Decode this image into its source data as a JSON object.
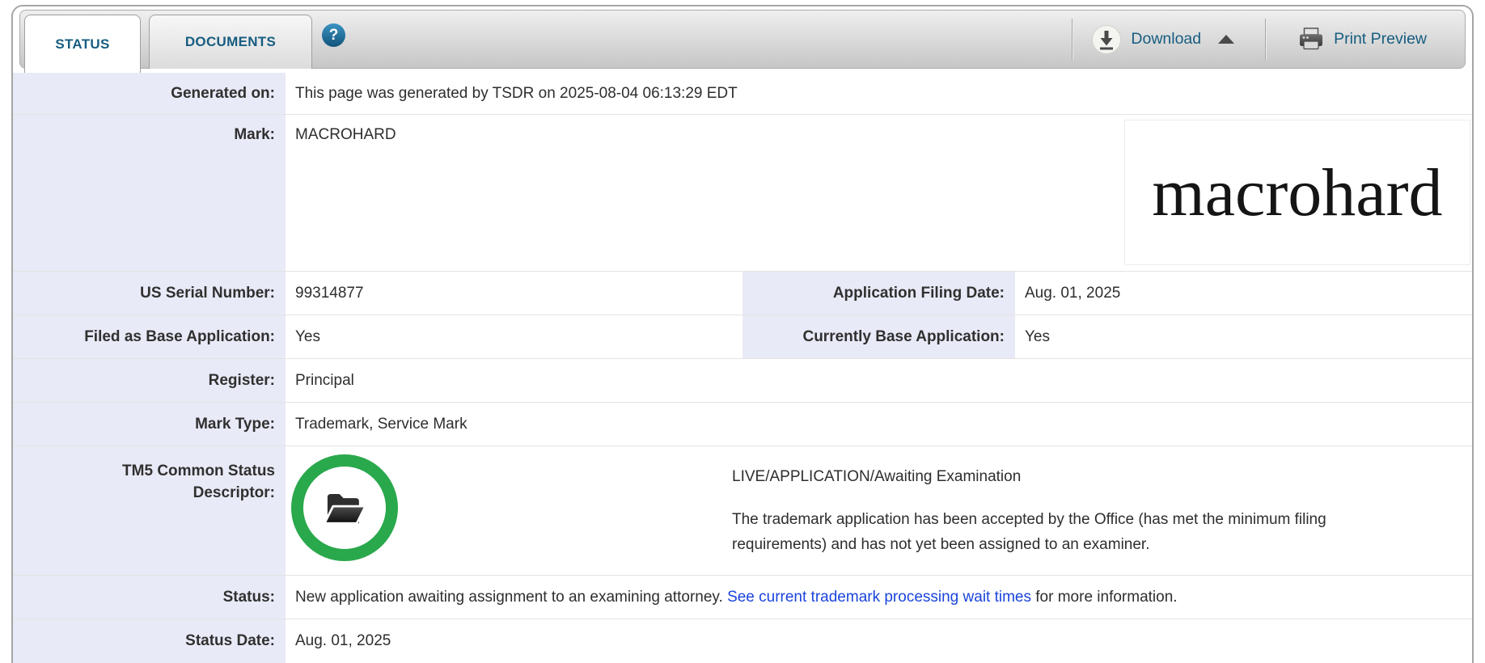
{
  "header": {
    "tabs": [
      {
        "label": "STATUS",
        "active": true
      },
      {
        "label": "DOCUMENTS",
        "active": false
      }
    ],
    "help": {
      "glyph": "?"
    },
    "actions": {
      "download_label": "Download",
      "print_preview_label": "Print Preview"
    }
  },
  "icons": {
    "help": "question-circle-icon",
    "download": "download-arrow-circle-icon",
    "download_caret": "caret-up-icon",
    "print": "printer-icon",
    "tm5": "open-folder-live-status-icon"
  },
  "colors": {
    "accent_teal": "#175d80",
    "link_blue": "#1a44db",
    "live_green": "#2aa84c",
    "label_bg": "#e9eaf7"
  },
  "record": {
    "generated_on": {
      "label": "Generated on:",
      "value": "This page was generated by TSDR on 2025-08-04 06:13:29 EDT"
    },
    "mark": {
      "label": "Mark:",
      "value": "MACROHARD",
      "image_text": "macrohard"
    },
    "us_serial_number": {
      "label": "US Serial Number:",
      "value": "99314877"
    },
    "application_filing_date": {
      "label": "Application Filing Date:",
      "value": "Aug. 01, 2025"
    },
    "filed_as_base_application": {
      "label": "Filed as Base Application:",
      "value": "Yes"
    },
    "currently_base_application": {
      "label": "Currently Base Application:",
      "value": "Yes"
    },
    "register": {
      "label": "Register:",
      "value": "Principal"
    },
    "mark_type": {
      "label": "Mark Type:",
      "value": "Trademark, Service Mark"
    },
    "tm5": {
      "label_line1": "TM5 Common Status",
      "label_line2": "Descriptor:",
      "status": "LIVE/APPLICATION/Awaiting Examination",
      "description": "The trademark application has been accepted by the Office (has met the minimum filing requirements) and has not yet been assigned to an examiner."
    },
    "status": {
      "label": "Status:",
      "value_before_link": "New application awaiting assignment to an examining attorney. ",
      "link_text": "See current trademark processing wait times",
      "value_after_link": " for more information."
    },
    "status_date": {
      "label": "Status Date:",
      "value": "Aug. 01, 2025"
    }
  }
}
